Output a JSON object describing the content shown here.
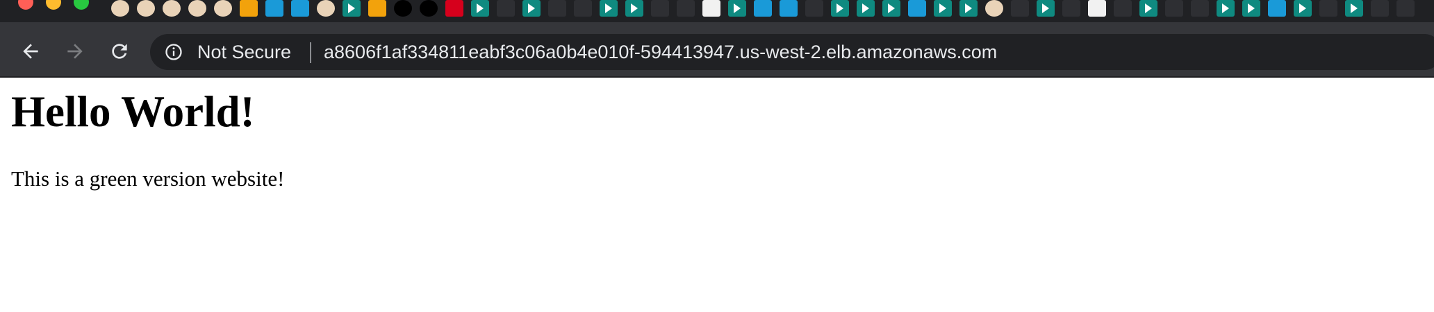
{
  "browser": {
    "security_label": "Not Secure",
    "url": "a8606f1af334811eabf3c06a0b4e010f-594413947.us-west-2.elb.amazonaws.com",
    "pinned_tabs": [
      "avatar",
      "avatar",
      "avatar",
      "avatar",
      "avatar",
      "orange",
      "blue",
      "blue",
      "avatar",
      "teal",
      "orange",
      "black",
      "black",
      "red",
      "teal",
      "dark",
      "teal",
      "dark",
      "dark",
      "teal",
      "teal",
      "dark",
      "dark",
      "white",
      "teal",
      "blue",
      "blue",
      "dark",
      "teal",
      "teal",
      "teal",
      "blue",
      "teal",
      "teal",
      "avatar",
      "dark",
      "teal",
      "dark",
      "white",
      "dark",
      "teal",
      "dark",
      "dark",
      "teal",
      "teal",
      "blue",
      "teal",
      "dark",
      "teal",
      "dark",
      "dark"
    ],
    "icons": {
      "back": "arrow-left-icon",
      "forward": "arrow-right-icon",
      "reload": "reload-icon",
      "info": "info-icon"
    },
    "colors": {
      "chrome_bg": "#35363a",
      "omnibox_bg": "#202124",
      "text": "#e8eaed",
      "forward_disabled": "#7b7d80"
    }
  },
  "page": {
    "heading": "Hello World!",
    "paragraph": "This is a green version website!"
  }
}
